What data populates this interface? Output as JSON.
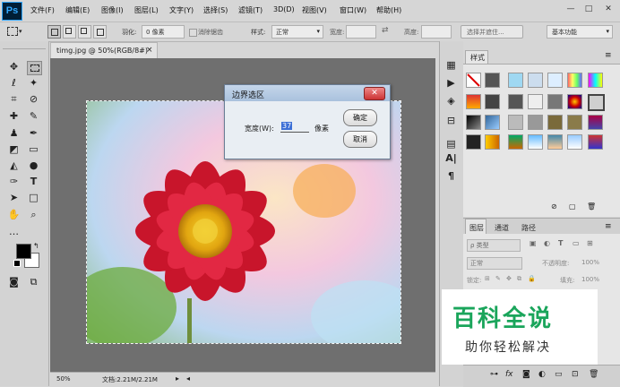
{
  "app": {
    "logo": "Ps"
  },
  "menu": [
    "文件(F)",
    "编辑(E)",
    "图像(I)",
    "图层(L)",
    "文字(Y)",
    "选择(S)",
    "滤镜(T)",
    "3D(D)",
    "视图(V)",
    "窗口(W)",
    "帮助(H)"
  ],
  "window_controls": {
    "minimize": "—",
    "maximize": "□",
    "close": "✕"
  },
  "options_bar": {
    "feather_label": "羽化:",
    "feather_value": "0 像素",
    "antialias_label": "消除锯齿",
    "style_label": "样式:",
    "style_value": "正常",
    "width_label": "宽度:",
    "height_label": "高度:",
    "select_mask_button": "选择并遮住...",
    "workspace": "基本功能"
  },
  "document": {
    "tab_title": "timg.jpg @ 50%(RGB/8#)",
    "tab_close": "×",
    "zoom": "50%",
    "doc_info": "文档:2.21M/2.21M"
  },
  "dialog": {
    "title": "边界选区",
    "width_label": "宽度(W):",
    "width_value": "37",
    "unit": "像素",
    "ok": "确定",
    "cancel": "取消"
  },
  "styles_panel": {
    "tab": "样式"
  },
  "layers_panel": {
    "tabs": [
      "图层",
      "通道",
      "路径"
    ],
    "filter_label": "ρ 类型",
    "blend_mode": "正常",
    "opacity_label": "不透明度:",
    "opacity_value": "100%",
    "lock_label": "锁定:",
    "fill_label": "填充:",
    "fill_value": "100%"
  },
  "watermark": {
    "title": "百科全说",
    "subtitle": "助你轻松解决"
  },
  "colors": {
    "accent": "#c0392b",
    "brand_blue": "#31a8ff",
    "watermark_green": "#1aa55b"
  }
}
